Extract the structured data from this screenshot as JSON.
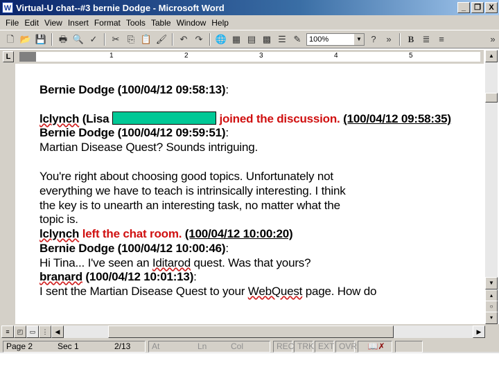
{
  "window": {
    "title": "Virtual-U chat--#3 bernie Dodge - Microsoft Word",
    "app_icon": "W",
    "minimize": "_",
    "restore": "❐",
    "close": "X"
  },
  "menu": [
    "File",
    "Edit",
    "View",
    "Insert",
    "Format",
    "Tools",
    "Table",
    "Window",
    "Help"
  ],
  "toolbar": {
    "zoom": "100%",
    "bold": "B"
  },
  "ruler": {
    "tab_button": "L",
    "marks": [
      "1",
      "2",
      "3",
      "4",
      "5"
    ]
  },
  "document": {
    "lines": [
      {
        "parts": [
          {
            "t": "Bernie Dodge (100/04/12 09:58:13)",
            "s": "b"
          },
          {
            "t": ":",
            "s": ""
          }
        ]
      },
      {
        "parts": [
          {
            "t": "lclynch",
            "s": "b squig"
          },
          {
            "t": " (Lisa ",
            "s": "b"
          },
          {
            "t": "",
            "s": "redact"
          },
          {
            "t": " joined the discussion.",
            "s": "red"
          },
          {
            "t": " ",
            "s": ""
          },
          {
            "t": "(100/04/12 09:58:35)",
            "s": "b u"
          }
        ]
      },
      {
        "parts": [
          {
            "t": "Bernie Dodge (100/04/12 09:59:51)",
            "s": "b"
          },
          {
            "t": ":",
            "s": ""
          }
        ]
      },
      {
        "parts": [
          {
            "t": "Martian Disease Quest? Sounds intriguing.",
            "s": ""
          }
        ]
      },
      {
        "parts": [
          {
            "t": "You're right about choosing good topics. Unfortunately not",
            "s": ""
          }
        ]
      },
      {
        "parts": [
          {
            "t": "everything we have to teach is intrinsically interesting. I think",
            "s": ""
          }
        ]
      },
      {
        "parts": [
          {
            "t": "the key is to unearth an interesting task, no matter what the",
            "s": ""
          }
        ]
      },
      {
        "parts": [
          {
            "t": "topic is.",
            "s": ""
          }
        ]
      },
      {
        "parts": [
          {
            "t": "lclynch",
            "s": "b squig"
          },
          {
            "t": " left the chat room.",
            "s": "red"
          },
          {
            "t": " ",
            "s": ""
          },
          {
            "t": "(100/04/12 10:00:20)",
            "s": "b u"
          }
        ]
      },
      {
        "parts": [
          {
            "t": "Bernie Dodge (100/04/12 10:00:46)",
            "s": "b"
          },
          {
            "t": ":",
            "s": ""
          }
        ]
      },
      {
        "parts": [
          {
            "t": "Hi Tina... I've seen an ",
            "s": ""
          },
          {
            "t": "Iditarod",
            "s": "squig"
          },
          {
            "t": " quest. Was that yours?",
            "s": ""
          }
        ]
      },
      {
        "parts": [
          {
            "t": "branard",
            "s": "b squig"
          },
          {
            "t": " (100/04/12 10:01:13)",
            "s": "b"
          },
          {
            "t": ":",
            "s": ""
          }
        ]
      },
      {
        "parts": [
          {
            "t": "I sent the Martian Disease Quest to your ",
            "s": ""
          },
          {
            "t": "WebQuest",
            "s": "squig"
          },
          {
            "t": " page. How do",
            "s": ""
          }
        ]
      }
    ]
  },
  "status": {
    "page": "Page 2",
    "sec": "Sec 1",
    "pos": "2/13",
    "at": "At",
    "ln": "Ln",
    "col": "Col",
    "rec": "REC",
    "trk": "TRK",
    "ext": "EXT",
    "ovr": "OVR"
  }
}
